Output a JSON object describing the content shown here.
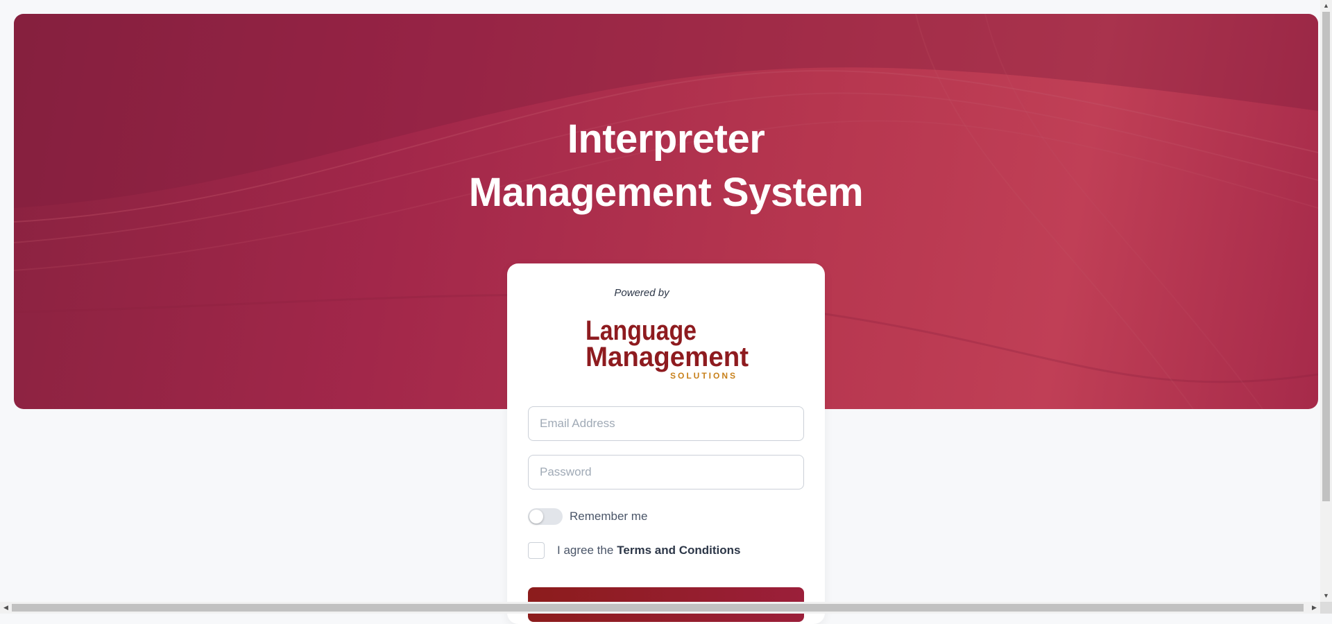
{
  "hero": {
    "title_line1": "Interpreter",
    "title_line2": "Management System"
  },
  "login": {
    "powered_by": "Powered by",
    "logo": {
      "line1": "Language",
      "line2": "Management",
      "line3": "SOLUTIONS",
      "primary_color": "#8e1b1f",
      "accent_color": "#c8801a"
    },
    "email_placeholder": "Email Address",
    "password_placeholder": "Password",
    "remember_label": "Remember me",
    "remember_checked": false,
    "agree_prefix": "I agree the",
    "terms_link": "Terms and Conditions",
    "agree_checked": false
  },
  "colors": {
    "hero_base": "#a2274a",
    "button": "#8c1c1c"
  },
  "scrollbars": {
    "up": "▲",
    "down": "▼",
    "left": "◀",
    "right": "▶"
  }
}
